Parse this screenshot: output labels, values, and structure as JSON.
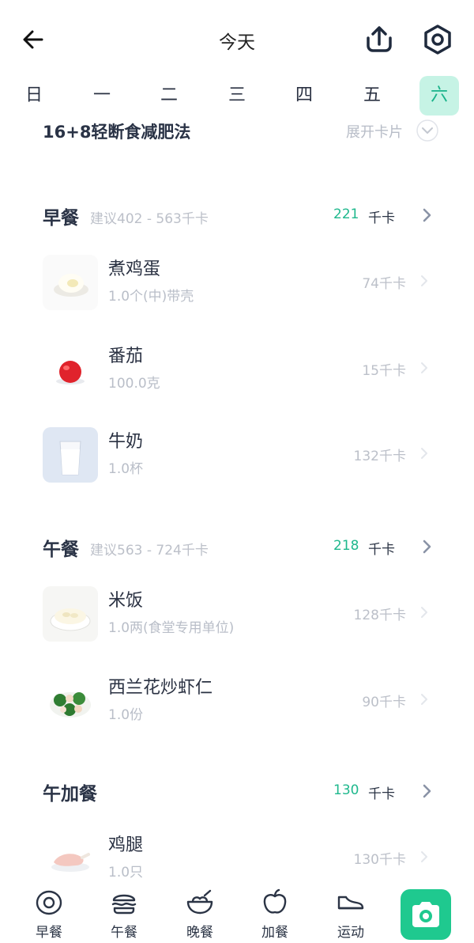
{
  "header": {
    "title": "今天"
  },
  "weekdays": [
    "日",
    "一",
    "二",
    "三",
    "四",
    "五",
    "六"
  ],
  "plan": {
    "title": "16+8轻断食减肥法",
    "expand_label": "展开卡片"
  },
  "meals": [
    {
      "name": "早餐",
      "suggest": "建议402 - 563千卡",
      "kcal": "221",
      "unit": "千卡",
      "foods": [
        {
          "name": "煮鸡蛋",
          "qty": "1.0个(中)带壳",
          "kcal": "74千卡"
        },
        {
          "name": "番茄",
          "qty": "100.0克",
          "kcal": "15千卡"
        },
        {
          "name": "牛奶",
          "qty": "1.0杯",
          "kcal": "132千卡"
        }
      ]
    },
    {
      "name": "午餐",
      "suggest": "建议563 - 724千卡",
      "kcal": "218",
      "unit": "千卡",
      "foods": [
        {
          "name": "米饭",
          "qty": "1.0两(食堂专用单位)",
          "kcal": "128千卡"
        },
        {
          "name": "西兰花炒虾仁",
          "qty": "1.0份",
          "kcal": "90千卡"
        }
      ]
    },
    {
      "name": "午加餐",
      "suggest": "",
      "kcal": "130",
      "unit": "千卡",
      "foods": [
        {
          "name": "鸡腿",
          "qty": "1.0只",
          "kcal": "130千卡"
        }
      ]
    }
  ],
  "tabs": [
    {
      "label": "早餐",
      "icon": "egg-icon"
    },
    {
      "label": "午餐",
      "icon": "burger-icon"
    },
    {
      "label": "晚餐",
      "icon": "bowl-icon"
    },
    {
      "label": "加餐",
      "icon": "apple-icon"
    },
    {
      "label": "运动",
      "icon": "shoe-icon"
    }
  ],
  "colors": {
    "accent": "#1fc98f",
    "kcal": "#1fb88d",
    "active_day_bg": "#c6f3e5"
  }
}
